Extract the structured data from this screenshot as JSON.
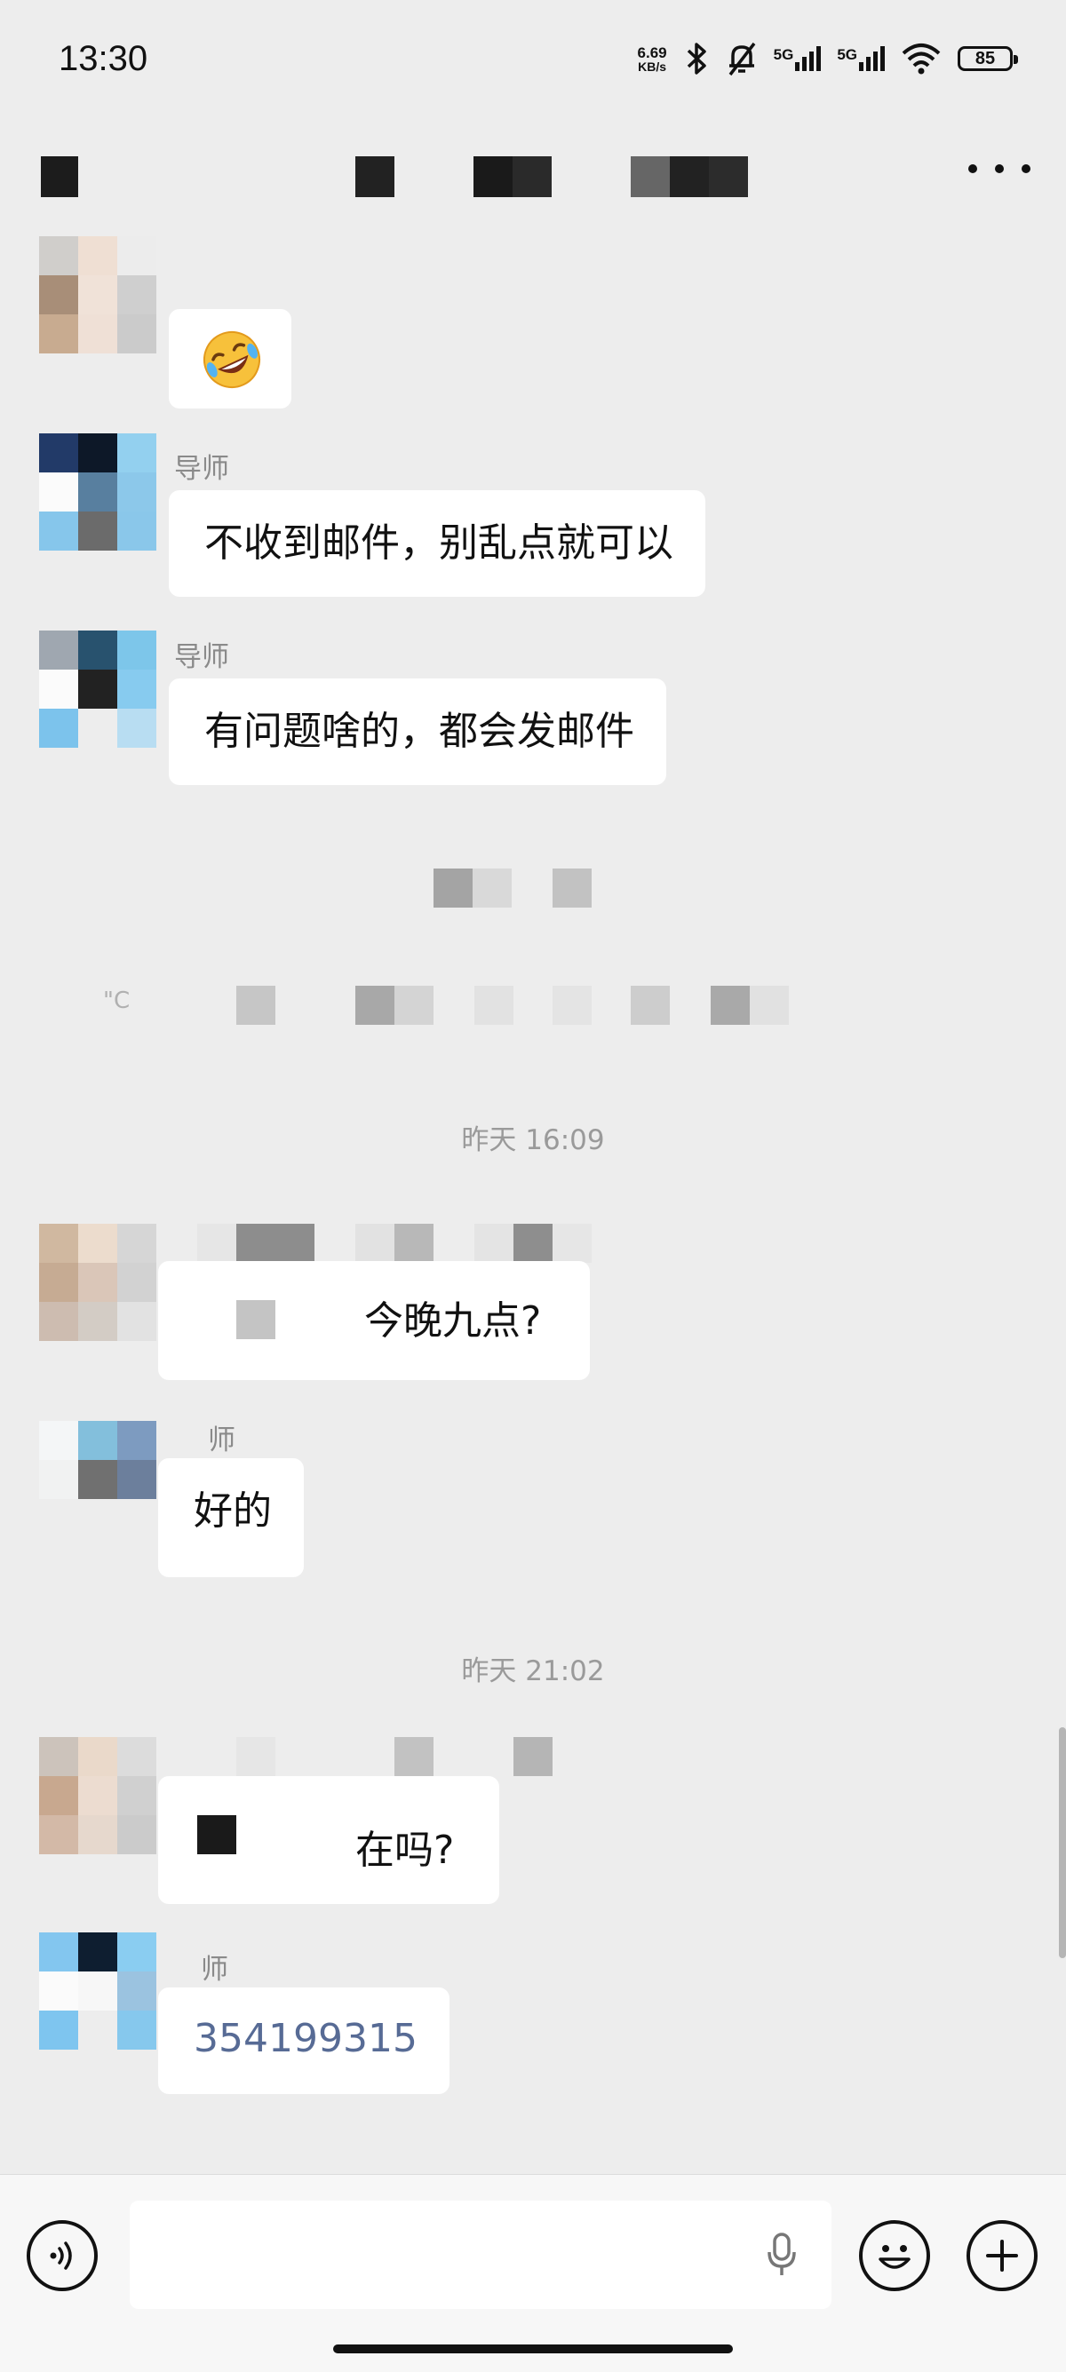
{
  "status_bar": {
    "time": "13:30",
    "net_speed_value": "6.69",
    "net_speed_unit": "KB/s",
    "signal1_label": "5G",
    "signal2_label": "5G",
    "battery": "85",
    "icons": [
      "bluetooth-icon",
      "mute-bell-icon",
      "signal-icon",
      "wifi-icon",
      "battery-icon"
    ]
  },
  "header": {
    "title_obscured": true,
    "more_icon": "more-dots-icon"
  },
  "messages": [
    {
      "type": "emoji",
      "content": "rolling-laughing-emoji"
    },
    {
      "type": "text",
      "sender": "导师",
      "text": "不收到邮件，别乱点就可以"
    },
    {
      "type": "text",
      "sender": "导师",
      "text": "有问题啥的，都会发邮件"
    },
    {
      "type": "system_obscured",
      "text": "\"C"
    },
    {
      "type": "timestamp",
      "text": "昨天 16:09"
    },
    {
      "type": "text",
      "sender": "",
      "text": "今晚九点?"
    },
    {
      "type": "text",
      "sender": "师",
      "text": "好的"
    },
    {
      "type": "timestamp",
      "text": "昨天 21:02"
    },
    {
      "type": "text",
      "sender": "",
      "text": "在吗?"
    },
    {
      "type": "link",
      "sender": "师",
      "text": "354199315"
    }
  ],
  "composer": {
    "icons": [
      "voice-icon",
      "microphone-icon",
      "emoji-icon",
      "plus-icon"
    ]
  }
}
